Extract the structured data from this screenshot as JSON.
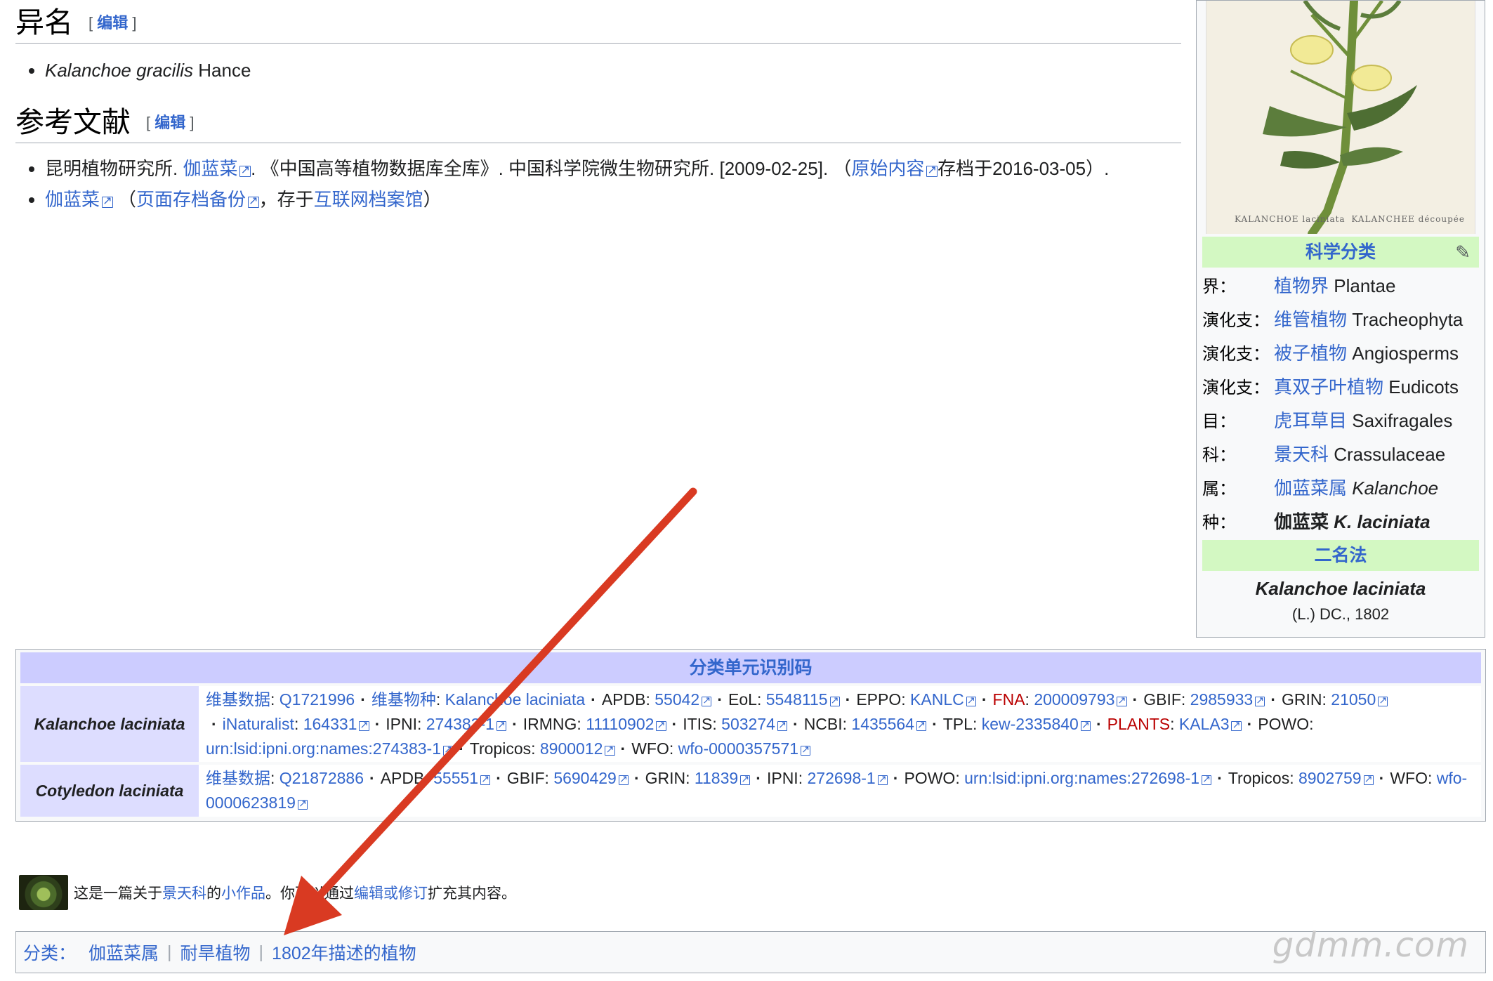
{
  "synonyms": {
    "heading": "异名",
    "edit_open": "[",
    "edit_label": "编辑",
    "edit_close": "]",
    "items": [
      {
        "name": "Kalanchoe gracilis",
        "author": "Hance"
      }
    ]
  },
  "references": {
    "heading": "参考文献",
    "edit_open": "[",
    "edit_label": "编辑",
    "edit_close": "]",
    "ref1": {
      "prefix": "昆明植物研究所. ",
      "link": "伽蓝菜",
      "middle": ". 《中国高等植物数据库全库》. 中国科学院微生物研究所. [2009-02-25]. （",
      "archive_link": "原始内容",
      "suffix": "存档于2016-03-05）."
    },
    "ref2": {
      "link": "伽蓝菜",
      "open": " （",
      "backup_link": "页面存档备份",
      "mid": "，存于",
      "archive_link": "互联网档案馆",
      "close": "）"
    }
  },
  "infobox": {
    "image_caption_left": "KALANCHOE   laciniata",
    "image_caption_right": "KALANCHEE   découpée",
    "sci_class_header": "科学分类",
    "rows": [
      {
        "rank": "界：",
        "zh": "植物界",
        "latin": "Plantae"
      },
      {
        "rank": "演化支：",
        "zh": "维管植物",
        "latin": "Tracheophyta"
      },
      {
        "rank": "演化支：",
        "zh": "被子植物",
        "latin": "Angiosperms"
      },
      {
        "rank": "演化支：",
        "zh": "真双子叶植物",
        "latin": "Eudicots"
      },
      {
        "rank": "目：",
        "zh": "虎耳草目",
        "latin": "Saxifragales"
      },
      {
        "rank": "科：",
        "zh": "景天科",
        "latin": "Crassulaceae"
      },
      {
        "rank": "属：",
        "zh": "伽蓝菜属",
        "latin": "Kalanchoe"
      },
      {
        "rank": "种：",
        "zh": "伽蓝菜",
        "latin": "K. laciniata"
      }
    ],
    "binomial_header": "二名法",
    "binomial": "Kalanchoe laciniata",
    "authority": "(L.) DC., 1802"
  },
  "authority_control": {
    "title": "分类单元识别码",
    "row1_name": "Kalanchoe laciniata",
    "row1": {
      "wikidata_label": "维基数据",
      "wikidata": "Q1721996",
      "wikispecies_label": "维基物种",
      "wikispecies": "Kalanchoe laciniata",
      "apdb_label": "APDB",
      "apdb": "55042",
      "eol_label": "EoL",
      "eol": "5548115",
      "eppo_label": "EPPO",
      "eppo": "KANLC",
      "fna_label": "FNA",
      "fna": "200009793",
      "gbif_label": "GBIF",
      "gbif": "2985933",
      "grin_label": "GRIN",
      "grin": "21050",
      "inat_label": "iNaturalist",
      "inat": "164331",
      "ipni_label": "IPNI",
      "ipni": "274383-1",
      "irmng_label": "IRMNG",
      "irmng": "11110902",
      "itis_label": "ITIS",
      "itis": "503274",
      "ncbi_label": "NCBI",
      "ncbi": "1435564",
      "tpl_label": "TPL",
      "tpl": "kew-2335840",
      "plants_label": "PLANTS",
      "plants": "KALA3",
      "powo_label": "POWO",
      "powo": "urn:lsid:ipni.org:names:274383-1",
      "tropicos_label": "Tropicos",
      "tropicos": "8900012",
      "wfo_label": "WFO",
      "wfo": "wfo-0000357571"
    },
    "row2_name": "Cotyledon laciniata",
    "row2": {
      "wikidata_label": "维基数据",
      "wikidata": "Q21872886",
      "apdb_label": "APDB",
      "apdb": "55551",
      "gbif_label": "GBIF",
      "gbif": "5690429",
      "grin_label": "GRIN",
      "grin": "11839",
      "ipni_label": "IPNI",
      "ipni": "272698-1",
      "powo_label": "POWO",
      "powo": "urn:lsid:ipni.org:names:272698-1",
      "tropicos_label": "Tropicos",
      "tropicos": "8902759",
      "wfo_label": "WFO",
      "wfo": "wfo-0000623819"
    }
  },
  "stub": {
    "p1": "这是一篇关于",
    "family_link": "景天科",
    "p2": "的",
    "stub_link": "小作品",
    "p3": "。你可以通过",
    "edit_link": "编辑或修订",
    "p4": "扩充其内容。"
  },
  "categories": {
    "label": "分类：",
    "items": [
      "伽蓝菜属",
      "耐旱植物",
      "1802年描述的植物"
    ]
  },
  "watermark": "gdmm.com",
  "colors": {
    "link": "#3366cc",
    "redlink": "#ba0000",
    "taxo_header": "#d3f8c2",
    "auth_header": "#ccccff",
    "annotation_arrow": "#d93a22"
  }
}
